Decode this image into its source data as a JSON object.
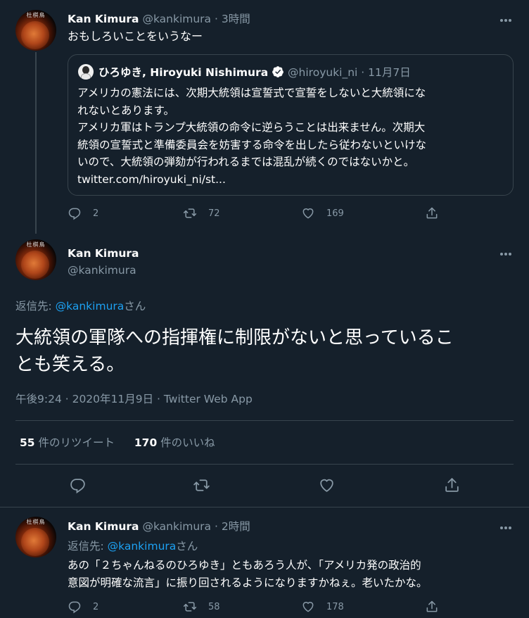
{
  "tweet1": {
    "avatar_text": "杜棋鳥",
    "name": "Kan Kimura",
    "handle": "@kankimura",
    "time": "3時間",
    "text": "おもしろいことをいうなー",
    "quote": {
      "name": "ひろゆき, Hiroyuki Nishimura",
      "handle": "@hiroyuki_ni",
      "date": "11月7日",
      "lines": [
        "アメリカの憲法には、次期大統領は宣誓式で宣誓をしないと大統領にな",
        "れないとあります。",
        "アメリカ軍はトランプ大統領の命令に逆らうことは出来ません。次期大",
        "統領の宣誓式と準備委員会を妨害する命令を出したら従わないといけな",
        "いので、大統領の弾劾が行われるまでは混乱が続くのではないかと。",
        "twitter.com/hiroyuki_ni/st..."
      ]
    },
    "replies": "2",
    "retweets": "72",
    "likes": "169"
  },
  "main": {
    "avatar_text": "杜棋鳥",
    "name": "Kan Kimura",
    "handle": "@kankimura",
    "reply_prefix": "返信先: ",
    "reply_to": "@kankimura",
    "reply_suffix": "さん",
    "text_line1": "大統領の軍隊への指揮権に制限がないと思っているこ",
    "text_line2": "とも笑える。",
    "meta": "午後9:24 · 2020年11月9日 · Twitter Web App",
    "retweet_count": "55",
    "retweet_label": " 件のリツイート",
    "like_count": "170",
    "like_label": " 件のいいね"
  },
  "tweet3": {
    "avatar_text": "杜棋鳥",
    "name": "Kan Kimura",
    "handle": "@kankimura",
    "time": "2時間",
    "reply_prefix": "返信先: ",
    "reply_to": "@kankimura",
    "reply_suffix": "さん",
    "line1": "あの「２ちゃんねるのひろゆき」ともあろう人が、「アメリカ発の政治的",
    "line2": "意図が明確な流言」に振り回されるようになりますかねぇ。老いたかな。",
    "replies": "2",
    "retweets": "58",
    "likes": "178"
  },
  "colors": {
    "background": "#15202b",
    "border": "#38444d",
    "secondary_text": "#8899a6",
    "link": "#1da1f2",
    "verified": "#ffffff"
  },
  "icons": [
    "reply-icon",
    "retweet-icon",
    "like-icon",
    "share-icon",
    "more-icon",
    "verified-icon"
  ]
}
